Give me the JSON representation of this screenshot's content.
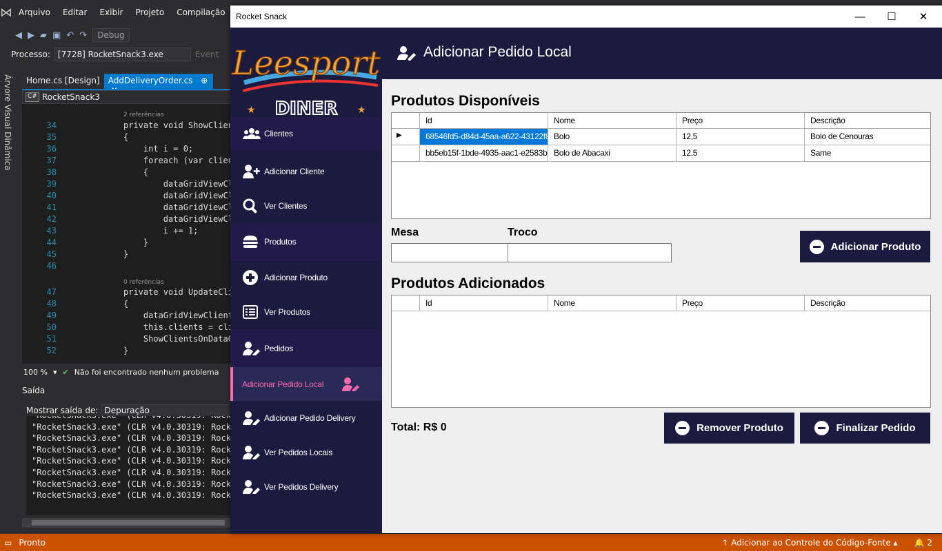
{
  "vs": {
    "menu": [
      "Arquivo",
      "Editar",
      "Exibir",
      "Projeto",
      "Compilação"
    ],
    "toolbar_config": "Debug",
    "process_label": "Processo:",
    "process_value": "[7728] RocketSnack3.exe",
    "events_label": "Event",
    "side_panel": "Árvore Visual Dinâmica",
    "tabs": [
      "Home.cs [Design]",
      "AddDeliveryOrder.cs"
    ],
    "tab_pin": "⊕",
    "tab_close": "✕",
    "crumb_badge": "C#",
    "crumb": "RocketSnack3",
    "refs2": "2 referências",
    "refs0": "0 referências",
    "code": [
      {
        "n": "34",
        "t": "private void ShowClien"
      },
      {
        "n": "35",
        "t": "{"
      },
      {
        "n": "36",
        "t": "    int i = 0;"
      },
      {
        "n": "37",
        "t": "    foreach (var clien"
      },
      {
        "n": "38",
        "t": "    {"
      },
      {
        "n": "39",
        "t": "        dataGridViewCl"
      },
      {
        "n": "40",
        "t": "        dataGridViewCl"
      },
      {
        "n": "41",
        "t": "        dataGridViewCl"
      },
      {
        "n": "42",
        "t": "        dataGridViewCl"
      },
      {
        "n": "43",
        "t": "        i += 1;"
      },
      {
        "n": "44",
        "t": "    }"
      },
      {
        "n": "45",
        "t": "}"
      },
      {
        "n": "46",
        "t": ""
      },
      {
        "n": "47",
        "t": "private void UpdateCli"
      },
      {
        "n": "48",
        "t": "{"
      },
      {
        "n": "49",
        "t": "    dataGridViewClient"
      },
      {
        "n": "50",
        "t": "    this.clients = cli"
      },
      {
        "n": "51",
        "t": "    ShowClientsOnDataG"
      },
      {
        "n": "52",
        "t": "}"
      }
    ],
    "zoom": "100 %",
    "no_problems": "Não foi encontrado nenhum problema",
    "output_title": "Saída",
    "output_show_label": "Mostrar saída de:",
    "output_show_value": "Depuração",
    "output_lines": [
      "\"RocketSnack3.exe\" (CLR v4.0.30319: Rocke",
      "\"RocketSnack3.exe\" (CLR v4.0.30319: Rocke",
      "\"RocketSnack3.exe\" (CLR v4.0.30319: Rocke",
      "\"RocketSnack3.exe\" (CLR v4.0.30319: Rocke",
      "\"RocketSnack3.exe\" (CLR v4.0.30319: Rocke",
      "\"RocketSnack3.exe\" (CLR v4.0.30319: Rocke",
      "\"RocketSnack3.exe\" (CLR v4.0.30319: Rocke",
      "\"RocketSnack3.exe\" (CLR v4.0.30319: Rocke"
    ],
    "status_ready": "Pronto",
    "status_source_control": "Adicionar ao Controle do Código-Fonte",
    "status_notifications": "2"
  },
  "app": {
    "title": "Rocket Snack",
    "logo_line1": "Leesport",
    "logo_line2": "DINER",
    "nav": [
      {
        "label": "Clientes",
        "icon": "users-icon"
      },
      {
        "label": "Adicionar Cliente",
        "icon": "user-plus-icon"
      },
      {
        "label": "Ver Clientes",
        "icon": "search-icon"
      },
      {
        "label": "Produtos",
        "icon": "hamburger-icon"
      },
      {
        "label": "Adicionar Produto",
        "icon": "plus-circle-icon"
      },
      {
        "label": "Ver Produtos",
        "icon": "list-icon"
      },
      {
        "label": "Pedidos",
        "icon": "user-edit-icon"
      },
      {
        "label": "Adicionar Pedido Local",
        "icon": "user-edit-icon"
      },
      {
        "label": "Adicionar Pedido Delivery",
        "icon": "user-edit-icon"
      },
      {
        "label": "Ver Pedidos Locais",
        "icon": "user-edit-icon"
      },
      {
        "label": "Ver Pedidos Delivery",
        "icon": "user-edit-icon"
      }
    ],
    "header_title": "Adicionar Pedido Local",
    "available_title": "Produtos Disponíveis",
    "columns": [
      "Id",
      "Nome",
      "Preço",
      "Descrição"
    ],
    "available_rows": [
      [
        "68546fd5-d84d-45aa-a622-43122f8...",
        "Bolo",
        "12,5",
        "Bolo de Cenouras"
      ],
      [
        "bb5eb15f-1bde-4935-aac1-e2583b...",
        "Bolo de Abacaxi",
        "12,5",
        "Same"
      ]
    ],
    "mesa_label": "Mesa",
    "troco_label": "Troco",
    "mesa_value": "",
    "troco_value": "",
    "add_product_btn": "Adicionar Produto",
    "added_title": "Produtos Adicionados",
    "total": "Total: R$ 0",
    "remove_btn": "Remover Produto",
    "finish_btn": "Finalizar Pedido",
    "colors": {
      "sidebar": "#1b1a3f",
      "accent": "#ff69b4",
      "selection": "#0078d7"
    }
  }
}
